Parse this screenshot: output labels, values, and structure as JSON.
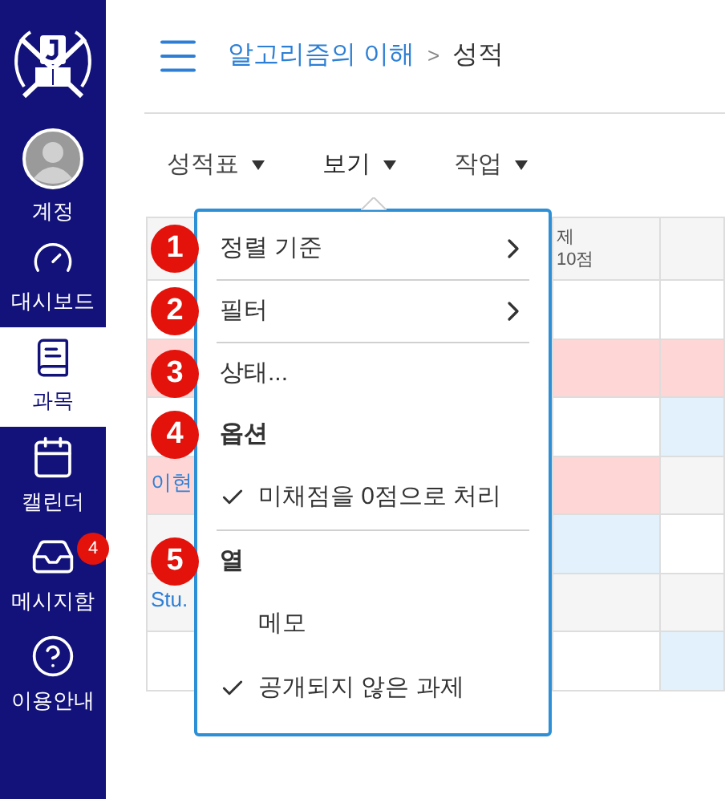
{
  "sidebar": {
    "items": [
      {
        "label": "계정",
        "selected": false
      },
      {
        "label": "대시보드",
        "selected": false
      },
      {
        "label": "과목",
        "selected": true
      },
      {
        "label": "캘린더",
        "selected": false
      },
      {
        "label": "메시지함",
        "selected": false,
        "badge": "4"
      },
      {
        "label": "이용안내",
        "selected": false
      }
    ]
  },
  "breadcrumb": {
    "course": "알고리즘의 이해",
    "separator": ">",
    "current": "성적"
  },
  "toolbar": [
    {
      "label": "성적표",
      "selected": false
    },
    {
      "label": "보기",
      "selected": true
    },
    {
      "label": "작업",
      "selected": false
    }
  ],
  "table": {
    "header": {
      "column_2_line_1": "제",
      "column_2_line_2": "10점"
    },
    "rows": [
      {
        "cells": [
          {
            "color": "#ffffff"
          },
          {
            "color": "#ffffff"
          },
          {
            "color": "#ffffff"
          }
        ]
      },
      {
        "cells": [
          {
            "color": "#ffd6d6"
          },
          {
            "color": "#ffd6d6"
          },
          {
            "color": "#ffd6d6"
          }
        ]
      },
      {
        "cells": [
          {
            "color": "#ffffff"
          },
          {
            "color": "#ffffff"
          },
          {
            "color": "#e3f1fc"
          }
        ]
      },
      {
        "name": "이현",
        "cells": [
          {
            "color": "#ffd6d6"
          },
          {
            "color": "#ffd6d6"
          },
          {
            "color": "#f5f5f5"
          }
        ]
      },
      {
        "cells": [
          {
            "color": "#f5f5f5"
          },
          {
            "color": "#e3f1fc"
          },
          {
            "color": "#ffffff"
          }
        ]
      },
      {
        "name": "Stu.",
        "cells": [
          {
            "color": "#f5f5f5"
          },
          {
            "color": "#f5f5f5"
          },
          {
            "color": "#f5f5f5"
          }
        ]
      },
      {
        "cells": [
          {
            "color": "#ffffff"
          },
          {
            "color": "#ffffff"
          },
          {
            "color": "#e3f1fc"
          }
        ]
      }
    ]
  },
  "menu": {
    "items": [
      {
        "kind": "submenu",
        "label": "정렬 기준",
        "callout": "1"
      },
      {
        "kind": "divider"
      },
      {
        "kind": "submenu",
        "label": "필터",
        "callout": "2"
      },
      {
        "kind": "divider"
      },
      {
        "kind": "action",
        "label": "상태...",
        "callout": "3"
      },
      {
        "kind": "heading",
        "label": "옵션",
        "callout": "4"
      },
      {
        "kind": "check",
        "label": "미채점을 0점으로 처리",
        "checked": true
      },
      {
        "kind": "divider"
      },
      {
        "kind": "heading",
        "label": "열",
        "callout": "5"
      },
      {
        "kind": "check",
        "label": "메모",
        "checked": false
      },
      {
        "kind": "check",
        "label": "공개되지 않은 과제",
        "checked": true
      }
    ]
  }
}
